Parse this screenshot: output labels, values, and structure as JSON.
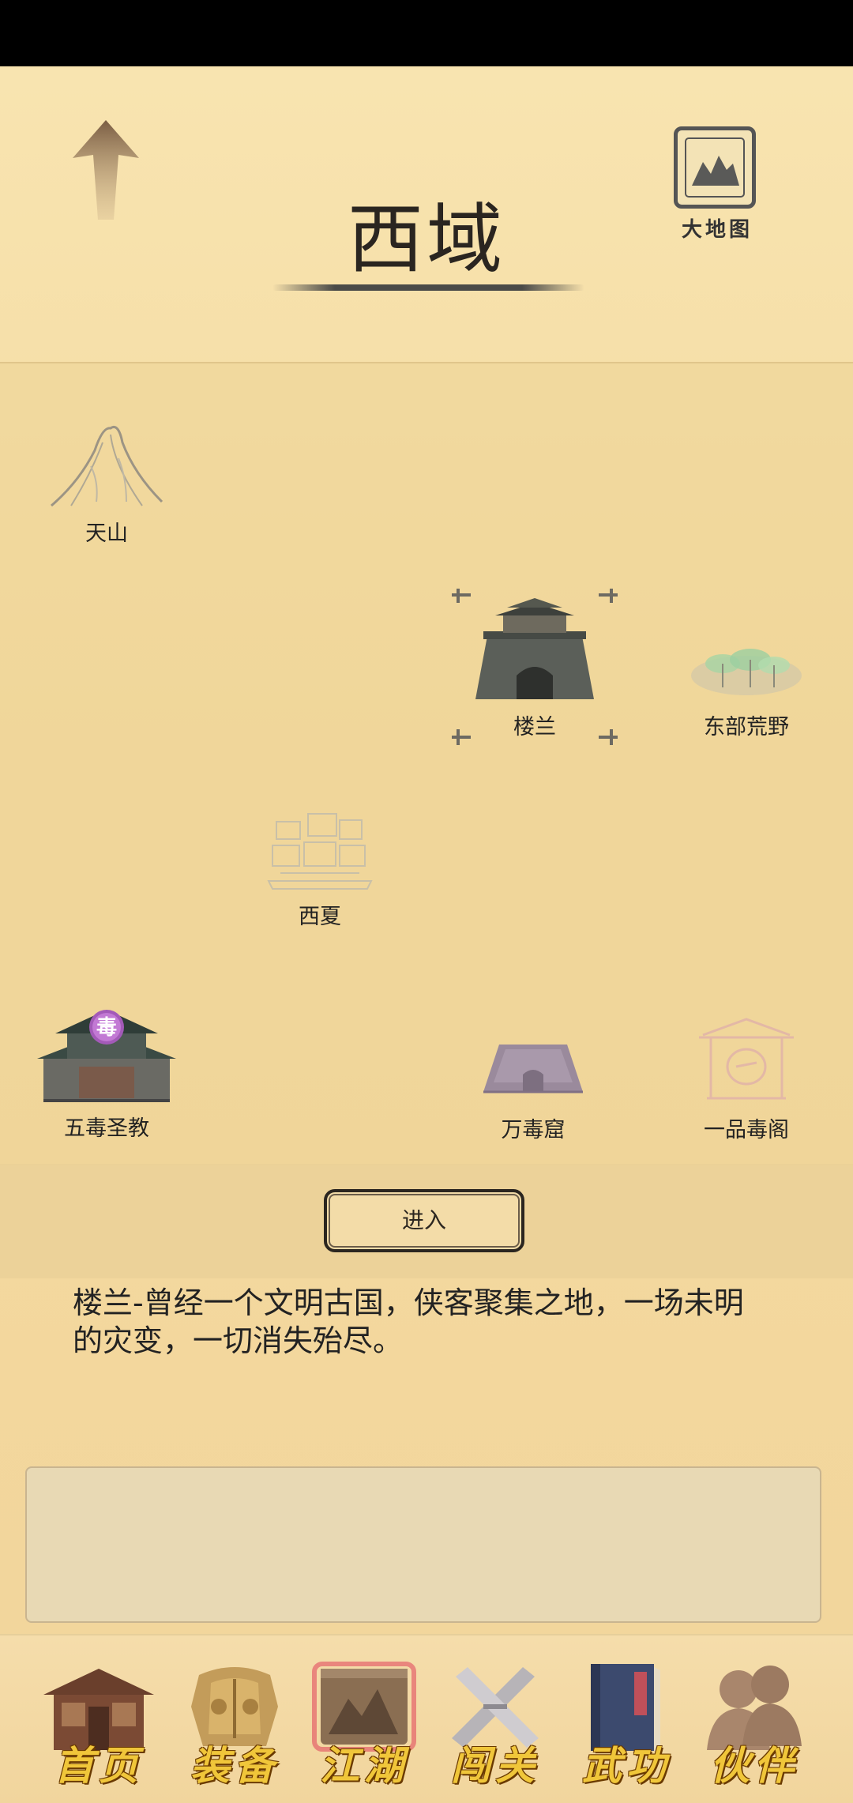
{
  "header": {
    "title": "西域",
    "worldmap_label": "大地图"
  },
  "locations": [
    {
      "name": "天山",
      "icon": "mountain-icon"
    },
    {
      "name": "楼兰",
      "icon": "city-gate-icon",
      "selected": true
    },
    {
      "name": "东部荒野",
      "icon": "wilderness-icon"
    },
    {
      "name": "西夏",
      "icon": "ruins-icon"
    },
    {
      "name": "五毒圣教",
      "icon": "poison-temple-icon",
      "badge": "毒"
    },
    {
      "name": "万毒窟",
      "icon": "cave-icon"
    },
    {
      "name": "一品毒阁",
      "icon": "pavilion-icon"
    }
  ],
  "actions": {
    "enter_label": "进入"
  },
  "description": "楼兰-曾经一个文明古国，侠客聚集之地，一场未明的灾变，一切消失殆尽。",
  "nav": [
    {
      "label": "首页",
      "icon": "house-icon"
    },
    {
      "label": "装备",
      "icon": "armor-icon"
    },
    {
      "label": "江湖",
      "icon": "scroll-map-icon",
      "active": true
    },
    {
      "label": "闯关",
      "icon": "crossed-swords-icon"
    },
    {
      "label": "武功",
      "icon": "book-icon"
    },
    {
      "label": "伙伴",
      "icon": "people-icon"
    }
  ],
  "colors": {
    "paper": "#f6dfa6",
    "text": "#2b2620",
    "nav_label": "#f0c63a",
    "active_glow": "#e0405a"
  }
}
